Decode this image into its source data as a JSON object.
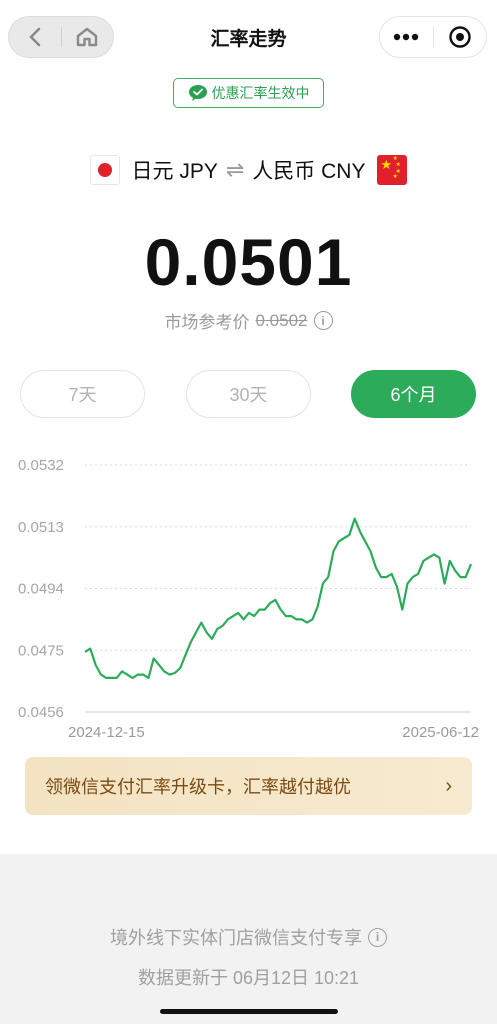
{
  "nav": {
    "title": "汇率走势",
    "back_icon": "chevron-left-icon",
    "home_icon": "home-icon",
    "more_icon": "more-dots-icon",
    "close_icon": "target-close-icon"
  },
  "promo": {
    "label": "优惠汇率生效中",
    "icon": "wechat-icon",
    "color": "#2aa14f"
  },
  "pair": {
    "from": "日元 JPY",
    "swap_symbol": "⇌",
    "to": "人民币 CNY",
    "from_flag": "japan-flag-icon",
    "to_flag": "china-flag-icon"
  },
  "rate": {
    "value": "0.0501",
    "market_label": "市场参考价",
    "market_value": "0.0502"
  },
  "tabs": [
    {
      "label": "7天",
      "active": false
    },
    {
      "label": "30天",
      "active": false
    },
    {
      "label": "6个月",
      "active": true
    }
  ],
  "chart_data": {
    "type": "line",
    "y_ticks": [
      "0.0532",
      "0.0513",
      "0.0494",
      "0.0475",
      "0.0456"
    ],
    "ylim": [
      0.0456,
      0.0532
    ],
    "x_labels": [
      "2024-12-15",
      "2025-06-12"
    ],
    "color": "#2cab5b",
    "grid": true,
    "series": [
      {
        "values": [
          0.04745,
          0.04755,
          0.04705,
          0.04675,
          0.04665,
          0.04665,
          0.04665,
          0.04685,
          0.04675,
          0.04665,
          0.04675,
          0.04675,
          0.04665,
          0.04725,
          0.04705,
          0.04685,
          0.04675,
          0.0468,
          0.04695,
          0.04735,
          0.04775,
          0.04805,
          0.04835,
          0.04805,
          0.04785,
          0.04815,
          0.04825,
          0.04845,
          0.04855,
          0.04865,
          0.04845,
          0.04865,
          0.04855,
          0.04875,
          0.04875,
          0.04895,
          0.04905,
          0.04875,
          0.04855,
          0.04855,
          0.04845,
          0.04845,
          0.04835,
          0.04845,
          0.04885,
          0.04955,
          0.04975,
          0.05055,
          0.05085,
          0.05095,
          0.05105,
          0.05155,
          0.05115,
          0.05085,
          0.05055,
          0.05005,
          0.04975,
          0.04975,
          0.04985,
          0.04945,
          0.04875,
          0.04955,
          0.04975,
          0.04985,
          0.05025,
          0.05035,
          0.05045,
          0.05035,
          0.04955,
          0.05025,
          0.04995,
          0.04975,
          0.04975,
          0.05015
        ]
      }
    ]
  },
  "banner": {
    "text": "领微信支付汇率升级卡，汇率越付越优",
    "arrow": "›"
  },
  "footer": {
    "note": "境外线下实体门店微信支付专享",
    "updated": "数据更新于 06月12日 10:21"
  }
}
